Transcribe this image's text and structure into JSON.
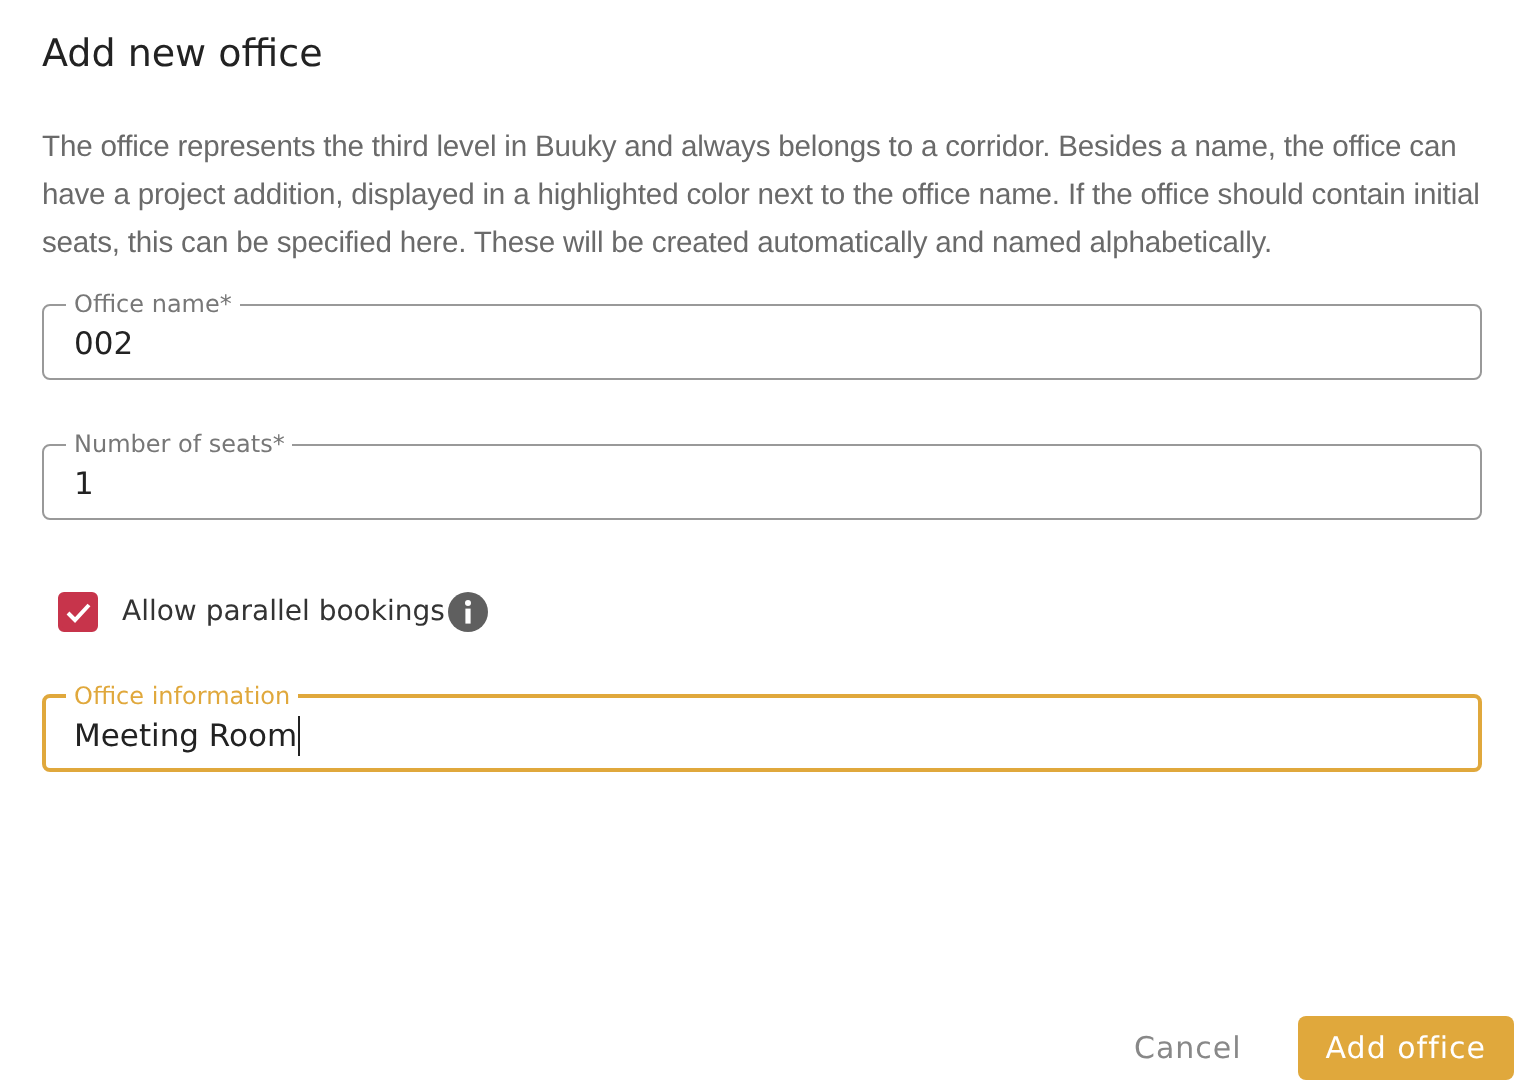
{
  "dialog": {
    "title": "Add new office",
    "description": "The office represents the third level in Buuky and always belongs to a corridor. Besides a name, the office can have a project addition, displayed in a highlighted color next to the office name. If the office should contain initial seats, this can be specified here. These will be created automatically and named alphabetically."
  },
  "fields": [
    {
      "kind": "text",
      "label": "Office name*",
      "value": "002",
      "focused": false
    },
    {
      "kind": "text",
      "label": "Number of seats*",
      "value": "1",
      "focused": false
    },
    {
      "kind": "checkbox",
      "label": "Allow parallel bookings",
      "checked": true,
      "info": true
    },
    {
      "kind": "text",
      "label": "Office information",
      "value": "Meeting Room",
      "focused": true
    }
  ],
  "buttons": [
    {
      "label": "Cancel",
      "kind": "text"
    },
    {
      "label": "Add office",
      "kind": "primary"
    }
  ]
}
